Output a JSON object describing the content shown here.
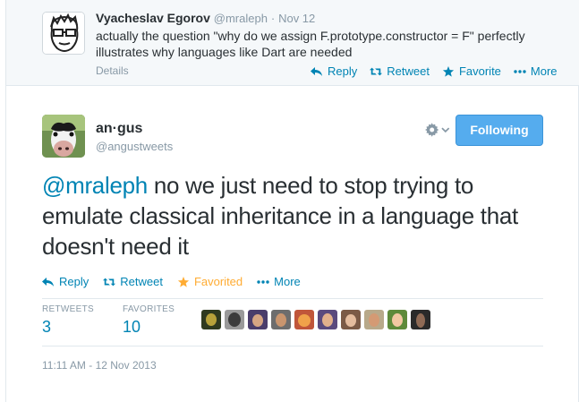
{
  "parent_tweet": {
    "name": "Vyacheslav Egorov",
    "handle": "@mraleph",
    "separator": "·",
    "date": "Nov 12",
    "text": "actually the question \"why do we assign F.prototype.constructor = F\" perfectly illustrates why languages like Dart are needed",
    "details_label": "Details",
    "actions": {
      "reply": "Reply",
      "retweet": "Retweet",
      "favorite": "Favorite",
      "more": "More"
    }
  },
  "tweet": {
    "name": "an·gus",
    "handle": "@angustweets",
    "follow_label": "Following",
    "mention": "@mraleph",
    "text": " no we just need to stop trying to emulate classical inheritance in a language that doesn't need it",
    "actions": {
      "reply": "Reply",
      "retweet": "Retweet",
      "favorited": "Favorited",
      "more": "More"
    },
    "stats": {
      "retweets_label": "RETWEETS",
      "retweets": "3",
      "favorites_label": "FAVORITES",
      "favorites": "10"
    },
    "timestamp": "11:11 AM - 12 Nov 2013"
  },
  "colors": {
    "link": "#0084b4",
    "follow_button": "#55acee",
    "favorited": "#ffac33",
    "muted": "#8899a6"
  },
  "icons": [
    "reply-icon",
    "retweet-icon",
    "star-icon",
    "more-dots-icon",
    "gear-icon",
    "chevron-down-icon"
  ],
  "favoriter_avatars_count": 10
}
